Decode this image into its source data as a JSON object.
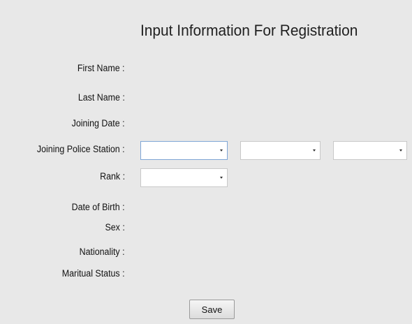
{
  "form": {
    "title": "Input Information For Registration",
    "labels": {
      "first_name": "First Name :",
      "last_name": "Last Name :",
      "joining_date": "Joining Date :",
      "joining_police_station": "Joining Police Station :",
      "rank": "Rank :",
      "date_of_birth": "Date of Birth :",
      "sex": "Sex :",
      "nationality": "Nationality :",
      "marital_status": "Maritual Status :"
    },
    "dropdowns": {
      "station_1": "",
      "station_2": "",
      "station_3": "",
      "rank": ""
    },
    "save_label": "Save"
  },
  "icons": {
    "dropdown_arrow": "chevron-down-icon"
  }
}
